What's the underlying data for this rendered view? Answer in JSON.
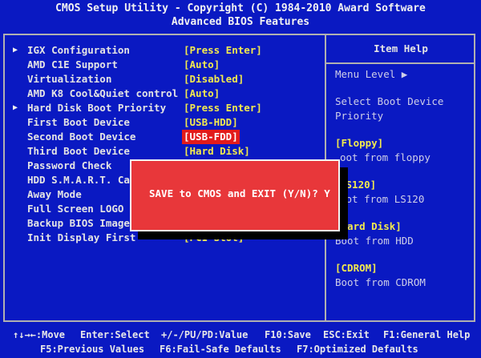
{
  "window": {
    "title_line1": "CMOS Setup Utility - Copyright (C) 1984-2010 Award Software",
    "title_line2": "Advanced BIOS Features"
  },
  "settings": [
    {
      "arrow": "▶",
      "label": "IGX Configuration",
      "value": "[Press Enter]"
    },
    {
      "arrow": "",
      "label": "AMD C1E Support",
      "value": "[Auto]"
    },
    {
      "arrow": "",
      "label": "Virtualization",
      "value": "[Disabled]"
    },
    {
      "arrow": "",
      "label": "AMD K8 Cool&Quiet control",
      "value": "[Auto]"
    },
    {
      "arrow": "▶",
      "label": "Hard Disk Boot Priority",
      "value": "[Press Enter]"
    },
    {
      "arrow": "",
      "label": "First Boot Device",
      "value": "[USB-HDD]"
    },
    {
      "arrow": "",
      "label": "Second Boot Device",
      "value": "[USB-FDD]",
      "selected": true
    },
    {
      "arrow": "",
      "label": "Third Boot Device",
      "value": "[Hard Disk]"
    },
    {
      "arrow": "",
      "label": "Password Check",
      "value": ""
    },
    {
      "arrow": "",
      "label": "HDD S.M.A.R.T. Ca",
      "value": ""
    },
    {
      "arrow": "",
      "label": "Away Mode",
      "value": ""
    },
    {
      "arrow": "",
      "label": "Full Screen LOGO",
      "value": ""
    },
    {
      "arrow": "",
      "label": "Backup BIOS Image",
      "value": ""
    },
    {
      "arrow": "",
      "label": "Init Display First",
      "value": "[PCI Slot]"
    }
  ],
  "help": {
    "title": "Item Help",
    "menu_level": "Menu Level  ▶",
    "desc1": "Select Boot Device",
    "desc2": "Priority",
    "floppy_label": "[Floppy]",
    "floppy_desc": "oot from floppy",
    "ls120_label": "LS120]",
    "ls120_desc": "oot from LS120",
    "hdd_label": "[Hard Disk]",
    "hdd_desc": "Boot from HDD",
    "cdrom_label": "[CDROM]",
    "cdrom_desc": "Boot from CDROM"
  },
  "dialog": {
    "text": "SAVE to CMOS and EXIT (Y/N)? Y"
  },
  "footer": {
    "line1_a": "↑↓→←:Move",
    "line1_b": "Enter:Select",
    "line1_c": "+/-/PU/PD:Value",
    "line1_d": "F10:Save",
    "line1_e": "ESC:Exit",
    "line1_f": "F1:General Help",
    "line2_a": "F5:Previous Values",
    "line2_b": "F6:Fail-Safe Defaults",
    "line2_c": "F7:Optimized Defaults"
  },
  "colors": {
    "background": "#0a19c2",
    "value_yellow": "#f2e94e",
    "dialog_red": "#e8373a",
    "selection_red": "#e21b1b"
  }
}
